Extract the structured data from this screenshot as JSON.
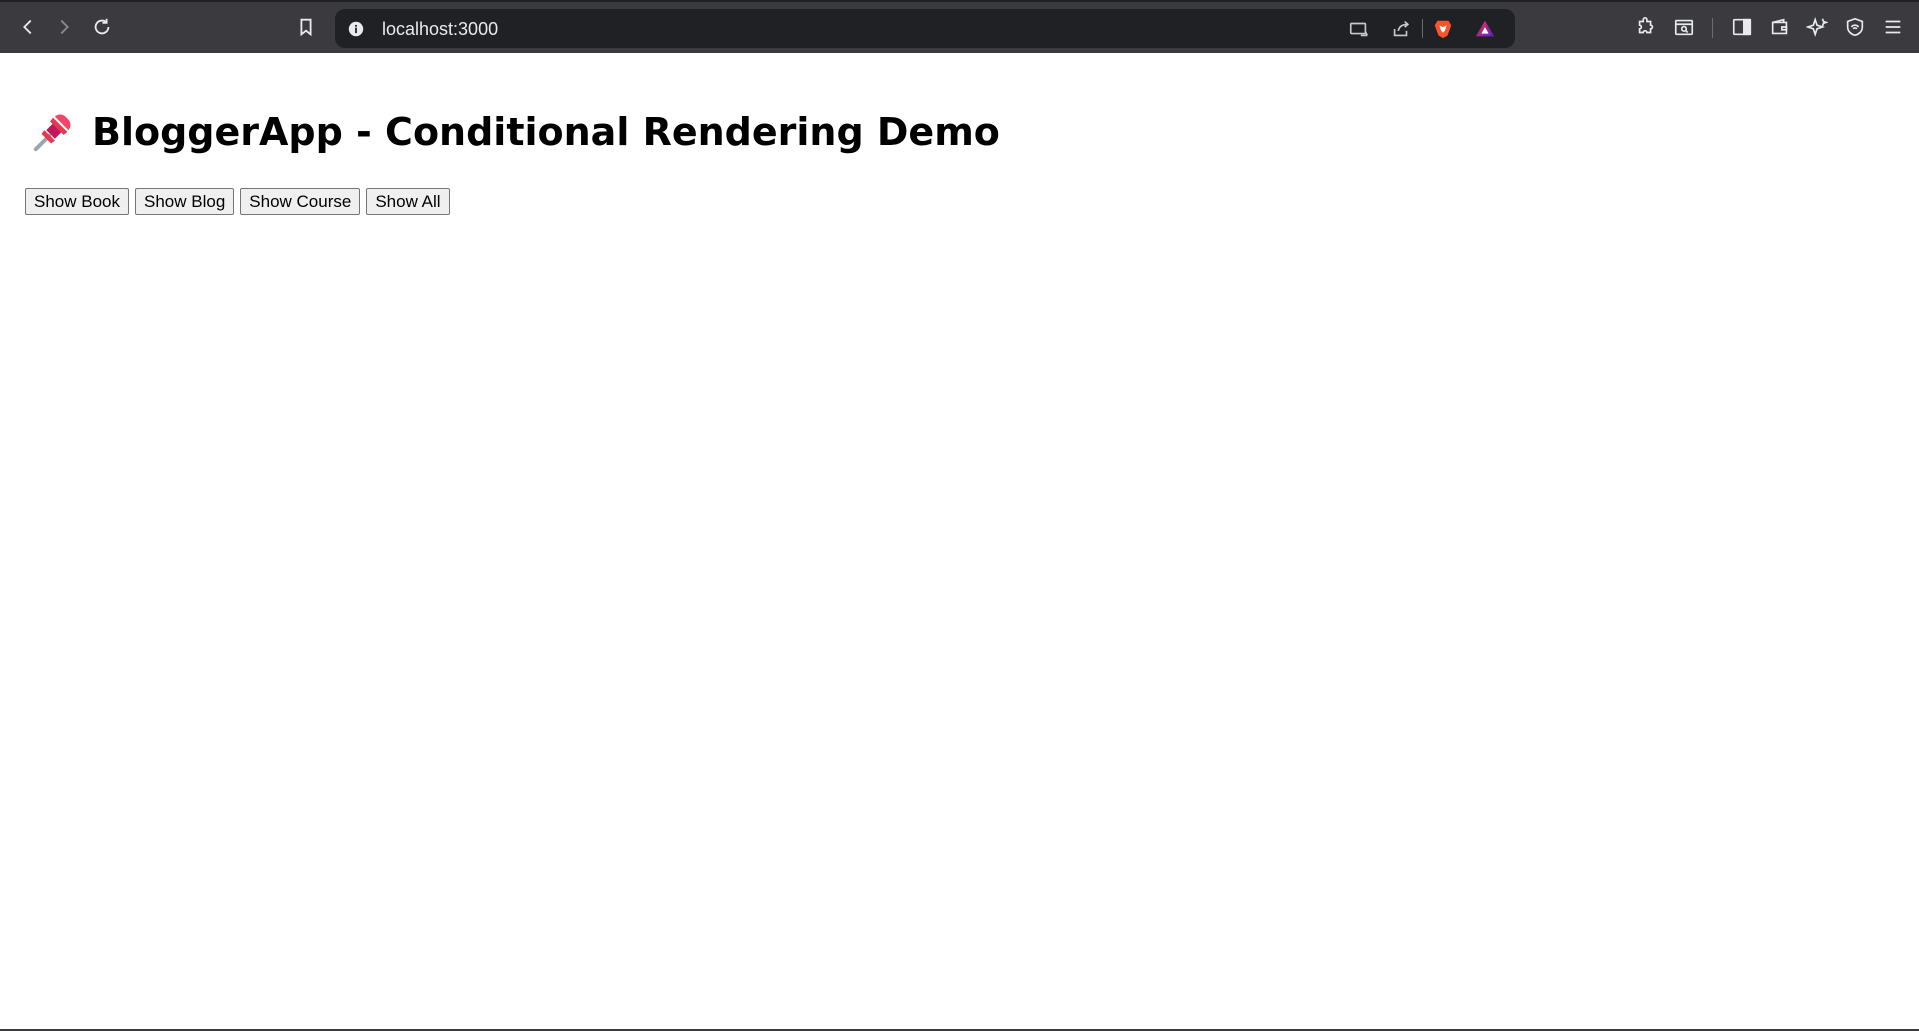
{
  "browser": {
    "url": "localhost:3000",
    "icons": [
      "back-icon",
      "forward-icon",
      "reload-icon",
      "bookmark-icon",
      "site-info-icon",
      "cast-icon",
      "share-icon",
      "brave-shields-icon",
      "brave-rewards-icon",
      "extensions-icon",
      "page-search-icon",
      "sidebar-icon",
      "wallet-icon",
      "leo-ai-icon",
      "vpn-icon",
      "menu-icon"
    ]
  },
  "page": {
    "title": "BloggerApp - Conditional Rendering Demo",
    "title_icon": "pushpin-icon",
    "buttons": [
      {
        "label": "Show Book"
      },
      {
        "label": "Show Blog"
      },
      {
        "label": "Show Course"
      },
      {
        "label": "Show All"
      }
    ]
  },
  "colors": {
    "toolbar_bg": "#3b3b3f",
    "address_bg": "#202124",
    "brave_orange": "#fb542b"
  }
}
